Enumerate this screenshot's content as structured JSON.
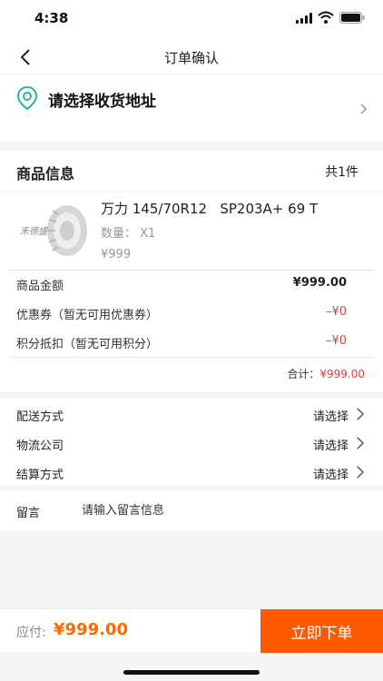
{
  "status_bar": {
    "time": "4:38"
  },
  "nav": {
    "title": "订单确认",
    "back_icon": "chevron-left-icon"
  },
  "address": {
    "placeholder": "请选择收货地址",
    "pin_color": "#2bb59a"
  },
  "goods": {
    "section_label": "商品信息",
    "count_text": "共1件",
    "item": {
      "image_alt": "禾德盛",
      "title": "万力 145/70R12   SP203A+ 69 T",
      "qty_label": "数量：",
      "qty_value": "X1",
      "price": "¥999"
    },
    "fees": [
      {
        "label": "商品金额",
        "value": "¥999.00",
        "style": "bold"
      },
      {
        "label": "优惠券（暂无可用优惠券）",
        "value": "–¥0",
        "style": "red"
      },
      {
        "label": "积分抵扣（暂无可用积分）",
        "value": "–¥0",
        "style": "red"
      }
    ],
    "subtotal_label": "合计：",
    "subtotal_value": "¥999.00"
  },
  "options": [
    {
      "label": "配送方式",
      "value": "请选择"
    },
    {
      "label": "物流公司",
      "value": "请选择"
    },
    {
      "label": "结算方式",
      "value": "请选择"
    }
  ],
  "message": {
    "label": "留言",
    "placeholder": "请输入留言信息"
  },
  "footer": {
    "pay_label": "应付:",
    "pay_value": "¥999.00",
    "submit_label": "立即下单",
    "accent": "#ff5a00"
  }
}
